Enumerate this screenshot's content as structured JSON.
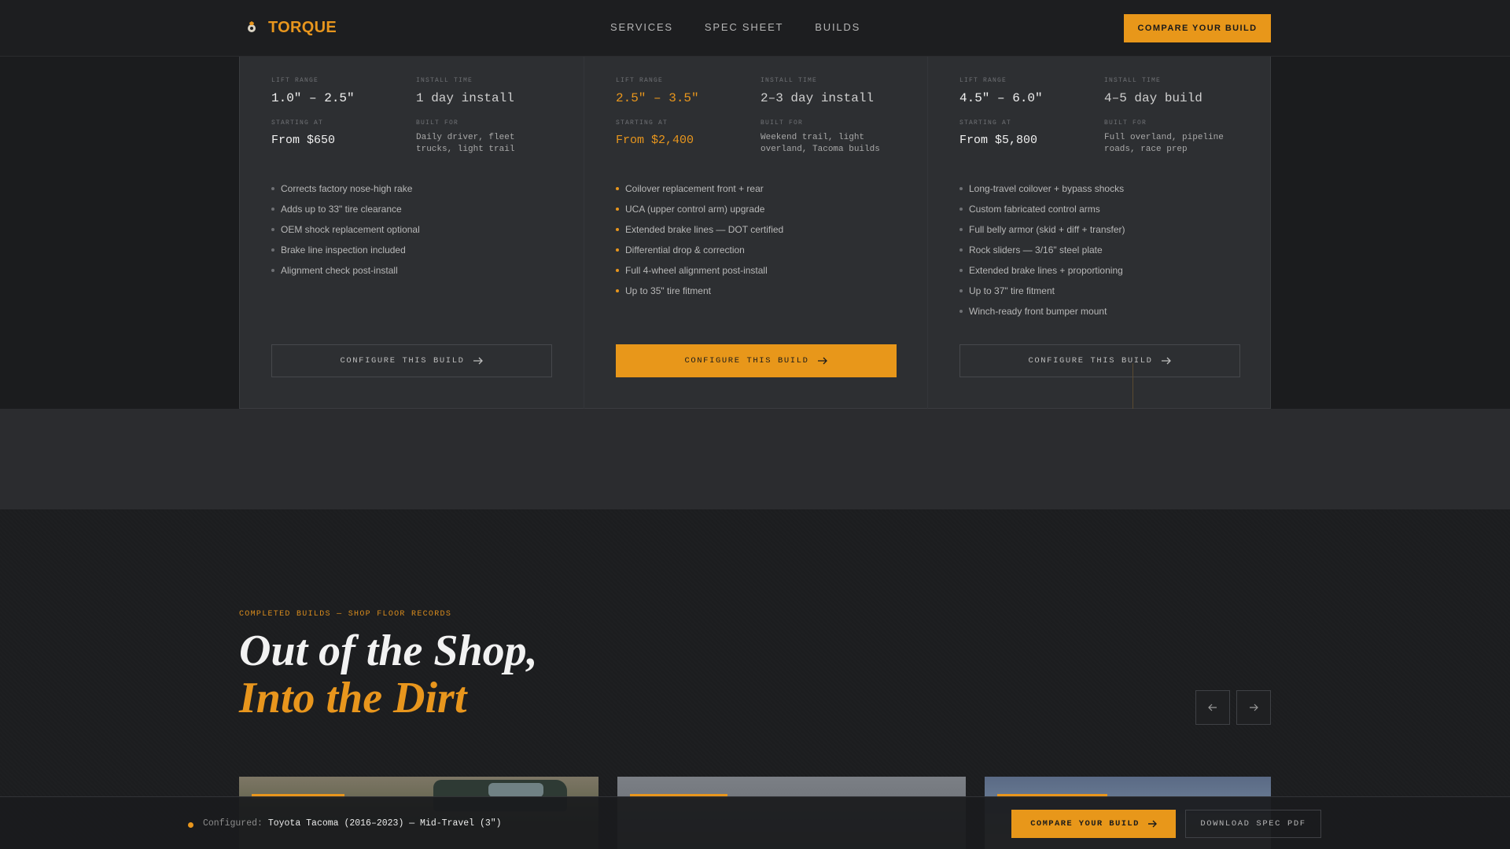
{
  "header": {
    "brand": "TORQUE",
    "nav": [
      "SERVICES",
      "SPEC SHEET",
      "BUILDS"
    ],
    "cta": "COMPARE YOUR BUILD"
  },
  "tiers": [
    {
      "lift_label": "LIFT RANGE",
      "lift": "1.0\" – 2.5\"",
      "install_label": "INSTALL TIME",
      "install": "1 day install",
      "price_label": "STARTING AT",
      "price": "From $650",
      "built_label": "BUILT FOR",
      "built": "Daily driver, fleet trucks, light trail",
      "features": [
        "Corrects factory nose-high rake",
        "Adds up to 33\" tire clearance",
        "OEM shock replacement optional",
        "Brake line inspection included",
        "Alignment check post-install"
      ],
      "button": "CONFIGURE THIS BUILD"
    },
    {
      "lift_label": "LIFT RANGE",
      "lift": "2.5\" – 3.5\"",
      "install_label": "INSTALL TIME",
      "install": "2–3 day install",
      "price_label": "STARTING AT",
      "price": "From $2,400",
      "built_label": "BUILT FOR",
      "built": "Weekend trail, light overland, Tacoma builds",
      "features": [
        "Coilover replacement front + rear",
        "UCA (upper control arm) upgrade",
        "Extended brake lines — DOT certified",
        "Differential drop & correction",
        "Full 4-wheel alignment post-install",
        "Up to 35\" tire fitment"
      ],
      "button": "CONFIGURE THIS BUILD"
    },
    {
      "lift_label": "LIFT RANGE",
      "lift": "4.5\" – 6.0\"",
      "install_label": "INSTALL TIME",
      "install": "4–5 day build",
      "price_label": "STARTING AT",
      "price": "From $5,800",
      "built_label": "BUILT FOR",
      "built": "Full overland, pipeline roads, race prep",
      "features": [
        "Long-travel coilover + bypass shocks",
        "Custom fabricated control arms",
        "Full belly armor (skid + diff + transfer)",
        "Rock sliders — 3/16\" steel plate",
        "Extended brake lines + proportioning",
        "Up to 37\" tire fitment",
        "Winch-ready front bumper mount"
      ],
      "button": "CONFIGURE THIS BUILD"
    }
  ],
  "builds": {
    "eyebrow": "COMPLETED BUILDS — SHOP FLOOR RECORDS",
    "headline_1": "Out of the Shop,",
    "headline_2": "Into the Dirt"
  },
  "sticky": {
    "label": "Configured:",
    "value": "Toyota Tacoma (2016–2023) — Mid-Travel (3\")",
    "cta": "COMPARE YOUR BUILD",
    "pdf": "DOWNLOAD SPEC PDF"
  },
  "colors": {
    "accent": "#e8961d",
    "background": "#1b1c1e",
    "panel": "#2d2f32"
  }
}
